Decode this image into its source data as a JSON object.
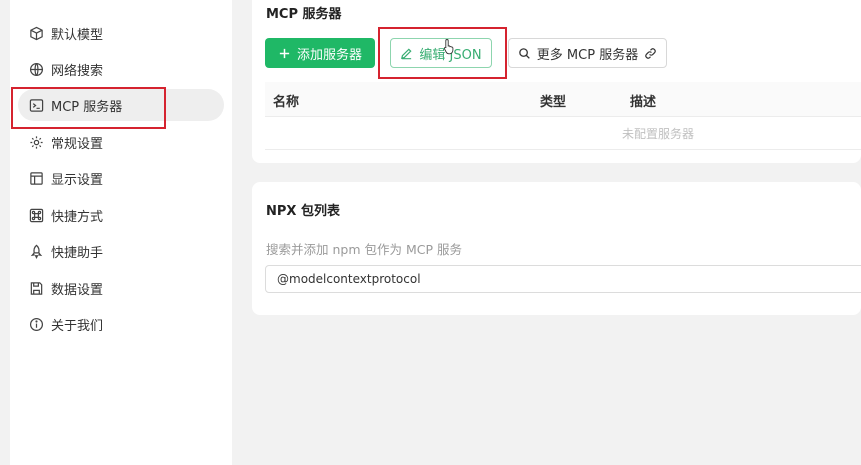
{
  "sidebar": {
    "items": [
      {
        "label": "默认模型",
        "icon": "cube-icon"
      },
      {
        "label": "网络搜索",
        "icon": "globe-icon"
      },
      {
        "label": "MCP 服务器",
        "icon": "terminal-icon"
      },
      {
        "label": "常规设置",
        "icon": "gear-icon"
      },
      {
        "label": "显示设置",
        "icon": "layout-icon"
      },
      {
        "label": "快捷方式",
        "icon": "command-icon"
      },
      {
        "label": "快捷助手",
        "icon": "rocket-icon"
      },
      {
        "label": "数据设置",
        "icon": "save-icon"
      },
      {
        "label": "关于我们",
        "icon": "info-icon"
      }
    ],
    "active_index": 2
  },
  "mcp": {
    "title": "MCP 服务器",
    "add_button": "添加服务器",
    "edit_json_button": "编辑 JSON",
    "more_button": "更多 MCP 服务器",
    "columns": [
      "名称",
      "类型",
      "描述"
    ],
    "empty_text": "未配置服务器"
  },
  "npx": {
    "title": "NPX 包列表",
    "hint": "搜索并添加 npm 包作为 MCP 服务",
    "input_value": "@modelcontextprotocol"
  },
  "colors": {
    "accent": "#1fb866",
    "highlight_box": "#d5232f"
  }
}
